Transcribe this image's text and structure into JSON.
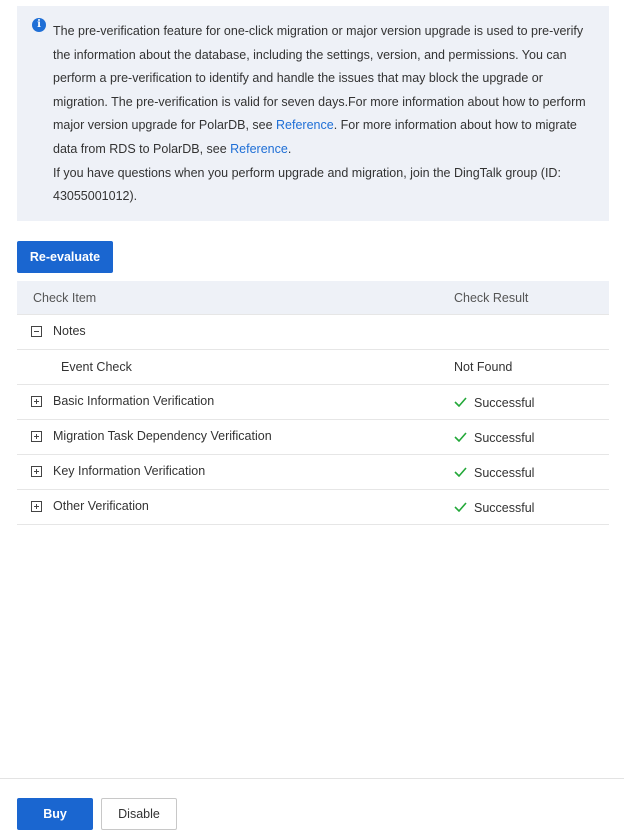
{
  "notice": {
    "icon": "info-icon",
    "text_part1": "The pre-verification feature for one-click migration or major version upgrade is used to pre-verify the information about the database, including the settings, version, and permissions. You can perform a pre-verification to identify and handle the issues that may block the upgrade or migration. The pre-verification is valid for seven days.For more information about how to perform major version upgrade for PolarDB, see ",
    "link1": "Reference",
    "text_part2": ". For more information about how to migrate data from RDS to PolarDB, see ",
    "link2": "Reference",
    "text_part3": ".",
    "text_line2": "If you have questions when you perform upgrade and migration, join the DingTalk group (ID: 43055001012)."
  },
  "toolbar": {
    "reevaluate_label": "Re-evaluate"
  },
  "table": {
    "headers": [
      "Check Item",
      "Check Result"
    ],
    "rows": [
      {
        "item": "Notes",
        "expanded": true,
        "result": ""
      },
      {
        "item": "Event Check",
        "child": true,
        "result": "Not Found"
      },
      {
        "item": "Basic Information Verification",
        "expanded": false,
        "result": "Successful"
      },
      {
        "item": "Migration Task Dependency Verification",
        "expanded": false,
        "result": "Successful"
      },
      {
        "item": "Key Information Verification",
        "expanded": false,
        "result": "Successful"
      },
      {
        "item": "Other Verification",
        "expanded": false,
        "result": "Successful"
      }
    ]
  },
  "footer": {
    "buy_label": "Buy",
    "disable_label": "Disable"
  },
  "colors": {
    "primary": "#1a66d0",
    "success": "#23a839",
    "notice_bg": "#eef1f7"
  }
}
